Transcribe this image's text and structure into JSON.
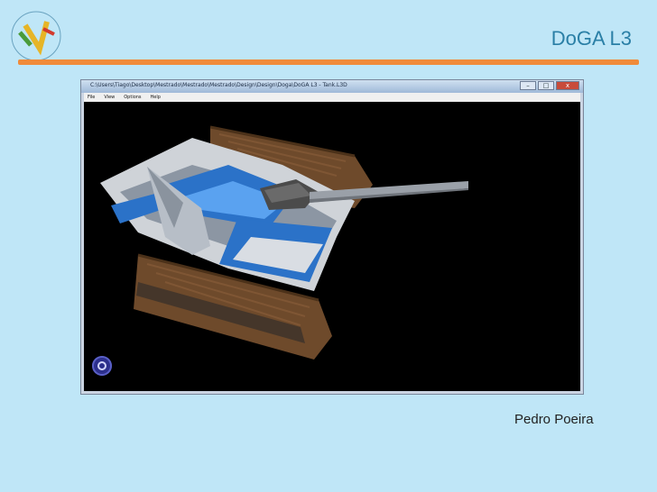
{
  "slide": {
    "title": "DoGA L3",
    "footer": "Pedro Poeira"
  },
  "window": {
    "title": "C:\\Users\\Tiago\\Desktop\\Mestrado\\Mestrado\\Mestrado\\Design\\Design\\Doga\\DoGA L3 - Tank.L3D",
    "controls": [
      "minimize",
      "maximize",
      "close"
    ],
    "menu": [
      "File",
      "View",
      "Options",
      "Help"
    ]
  },
  "colors": {
    "slide_bg": "#bfe6f7",
    "title_color": "#2a7fa6",
    "rule": "#f08b3a",
    "viewport_bg": "#000000"
  },
  "viewport": {
    "content": "3D tank model",
    "nav_icon": "orbit-icon"
  }
}
